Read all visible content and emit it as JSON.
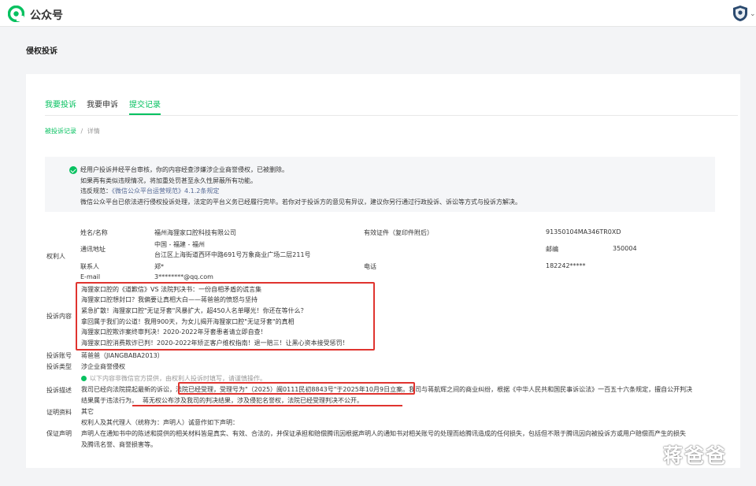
{
  "header": {
    "brand": "公众号"
  },
  "page": {
    "title": "侵权投诉"
  },
  "tabs": [
    {
      "label": "我要投诉"
    },
    {
      "label": "我要申诉"
    },
    {
      "label": "提交记录"
    }
  ],
  "breadcrumb": {
    "parent": "被投诉记录",
    "separator": "/",
    "current": "详情"
  },
  "notice": {
    "line1": "经用户投诉并经平台审核，你的内容经查涉嫌涉企业商誉侵权，已被删除。",
    "line2": "如果再有类似违规情况，将加重处罚甚至永久性屏蔽所有功能。",
    "rule_prefix": "违反规范：",
    "rule_link": "《微信公众平台运营规范》",
    "rule_suffix": "4.1.2条规定",
    "line4": "微信公众平台已依法进行侵权投诉处理，法定的平台义务已经履行完毕。若你对于投诉方的意见有异议，建议你另行通过行政投诉、诉讼等方式与投诉方解决。"
  },
  "rights_holder": {
    "section_label": "权利人",
    "name_label": "姓名/名称",
    "name": "福州海狸家口腔科技有限公司",
    "cert_label": "有效证件（复印件附后）",
    "cert": "91350104MA346TR0XD",
    "address_label": "通讯地址",
    "address_line1": "中国 - 福建 - 福州",
    "address_line2": "台江区上海街道西环中路691号万象商业广场二层211号",
    "zip_label": "邮编",
    "zip": "350004",
    "contact_label": "联系人",
    "contact": "郑*",
    "phone_label": "电话",
    "phone": "182242*****",
    "email_label": "E-mail",
    "email": "3********@qq.com"
  },
  "complaint": {
    "content_label": "投诉内容",
    "articles": [
      "海狸家口腔的《道歉信》VS 法院判决书：一份自相矛盾的谎言集",
      "海狸家口腔想封口？我偏要让真相大白——蒋爸爸的愤怒与坚持",
      "紧急扩散！海狸家口腔\"无证牙套\"风暴扩大，超450人名单曝光！你还在等什么？",
      "拿回属于我们的公道！我用900天，为女儿揭开海狸家口腔\"无证牙套\"的真相",
      "海狸家口腔欺诈案终审判决！2020-2022年牙套患者请立即自查！",
      "海狸家口腔消费欺诈已判！2020-2022年矫正客户维权指南！退一赔三！让黑心资本接受惩罚！"
    ],
    "account_label": "投诉账号",
    "account": "蒋爸爸（JIANGBABA2013）",
    "type_label": "投诉类型",
    "type": "涉企业商誉侵权",
    "info_note": "以下内容非微信官方提供，由权利人投诉时填写，请谨慎操作。",
    "desc_label": "投诉描述",
    "desc_part1": "我司已经向法院提起最新的诉讼，",
    "desc_highlight": "法院已经受理，受理号为\"（2025）闽0111民初8843号\"于2025年10月9日立案。",
    "desc_part2": "我司与蒋航辉之间的商业纠纷，根据《中华人民共和国民事诉讼法》一百五十六条规定，擅自公开判决",
    "desc_line2_a": "结果属于违法行为。",
    "desc_line2_b": "蒋无权公布涉及我司的判决结果，涉及侵犯名誉权，法院已经受理判决不公开。",
    "proof_label": "证明资料",
    "proof": "其它"
  },
  "guarantee": {
    "section_label": "保证声明",
    "line1": "权利人及其代理人（统称为：声明人）诚意作如下声明：",
    "line2": "声明人在通知书中的陈述和提供的相关材料皆是真实、有效、合法的，并保证承担和赔偿腾讯因根据声明人的通知书对相关账号的处理而给腾讯造成的任何损失，包括但不限于腾讯因向被投诉方或用户赔偿而产生的损失",
    "line3": "及腾讯名誉、商誉损害等。"
  },
  "watermark": "蒋爸爸"
}
